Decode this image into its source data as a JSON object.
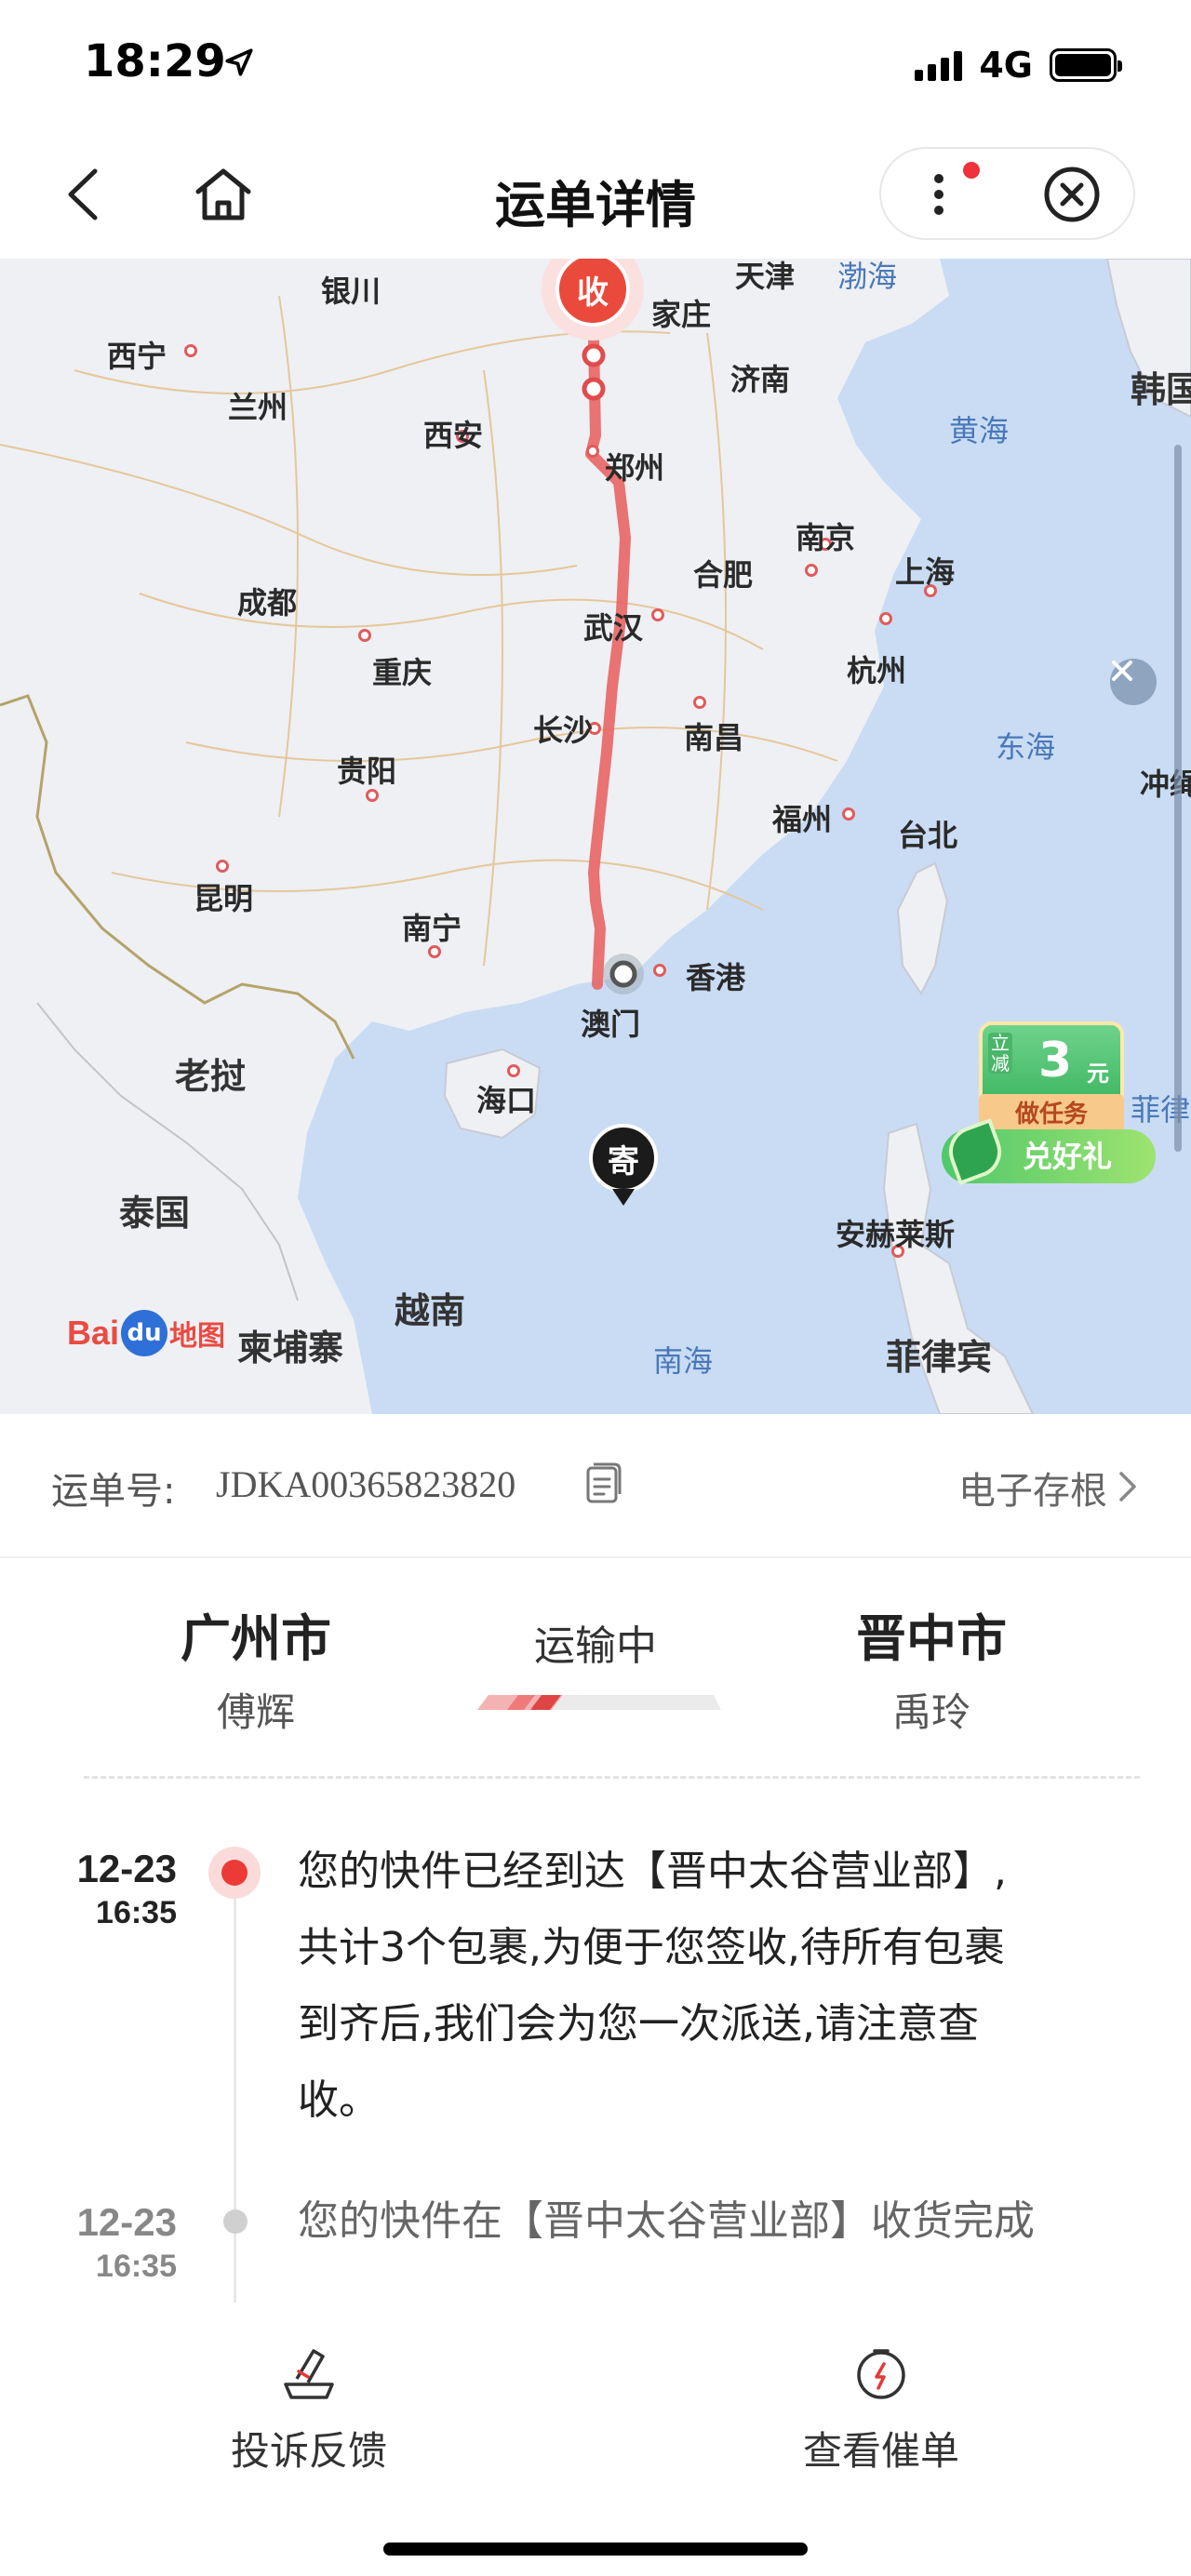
{
  "status_bar": {
    "time": "18:29",
    "network": "4G"
  },
  "nav": {
    "title": "运单详情"
  },
  "map": {
    "cities": [
      {
        "name": "银川"
      },
      {
        "name": "天津"
      },
      {
        "name": "家庄"
      },
      {
        "name": "西宁"
      },
      {
        "name": "兰州"
      },
      {
        "name": "济南"
      },
      {
        "name": "西安"
      },
      {
        "name": "郑州"
      },
      {
        "name": "南京"
      },
      {
        "name": "合肥"
      },
      {
        "name": "上海"
      },
      {
        "name": "成都"
      },
      {
        "name": "武汉"
      },
      {
        "name": "杭州"
      },
      {
        "name": "重庆"
      },
      {
        "name": "长沙"
      },
      {
        "name": "南昌"
      },
      {
        "name": "贵阳"
      },
      {
        "name": "福州"
      },
      {
        "name": "台北"
      },
      {
        "name": "昆明"
      },
      {
        "name": "南宁"
      },
      {
        "name": "香港"
      },
      {
        "name": "澳门"
      },
      {
        "name": "海口"
      },
      {
        "name": "老挝"
      },
      {
        "name": "泰国"
      },
      {
        "name": "越南"
      },
      {
        "name": "柬埔寨"
      },
      {
        "name": "安赫莱斯"
      },
      {
        "name": "菲律宾"
      },
      {
        "name": "韩国"
      },
      {
        "name": "冲绳"
      },
      {
        "name": "菲律"
      }
    ],
    "seas": [
      "黄海",
      "东海",
      "南海",
      "渤海"
    ],
    "marker_receive": "收",
    "marker_send": "寄",
    "logo": {
      "bai": "Bai",
      "du": "du",
      "suffix": "地图"
    },
    "promo": {
      "tag": "立减",
      "amount": "3",
      "unit": "元",
      "task": "做任务",
      "gift": "兑好礼"
    }
  },
  "waybill": {
    "label": "运单号:",
    "number": "JDKA00365823820",
    "receipt_link": "电子存根"
  },
  "route": {
    "from_city": "广州市",
    "from_name": "傅辉",
    "status": "运输中",
    "to_city": "晋中市",
    "to_name": "禹玲",
    "progress": 0.33
  },
  "timeline": [
    {
      "date": "12-23",
      "time": "16:35",
      "lines": [
        "您的快件已经到达【晋中太谷营业部】,",
        "共计3个包裹,为便于您签收,待所有包裹",
        "到齐后,我们会为您一次派送,请注意查",
        "收。"
      ],
      "active": true
    },
    {
      "date": "12-23",
      "time": "16:35",
      "lines": [
        "您的快件在【晋中太谷营业部】收货完成"
      ],
      "active": false
    }
  ],
  "bottom_bar": {
    "complaint": "投诉反馈",
    "urge": "查看催单"
  },
  "colors": {
    "accent": "#ec3b36",
    "route": "#e86a6a",
    "map_sea": "#c9dcf4",
    "map_land": "#eef0f4"
  }
}
